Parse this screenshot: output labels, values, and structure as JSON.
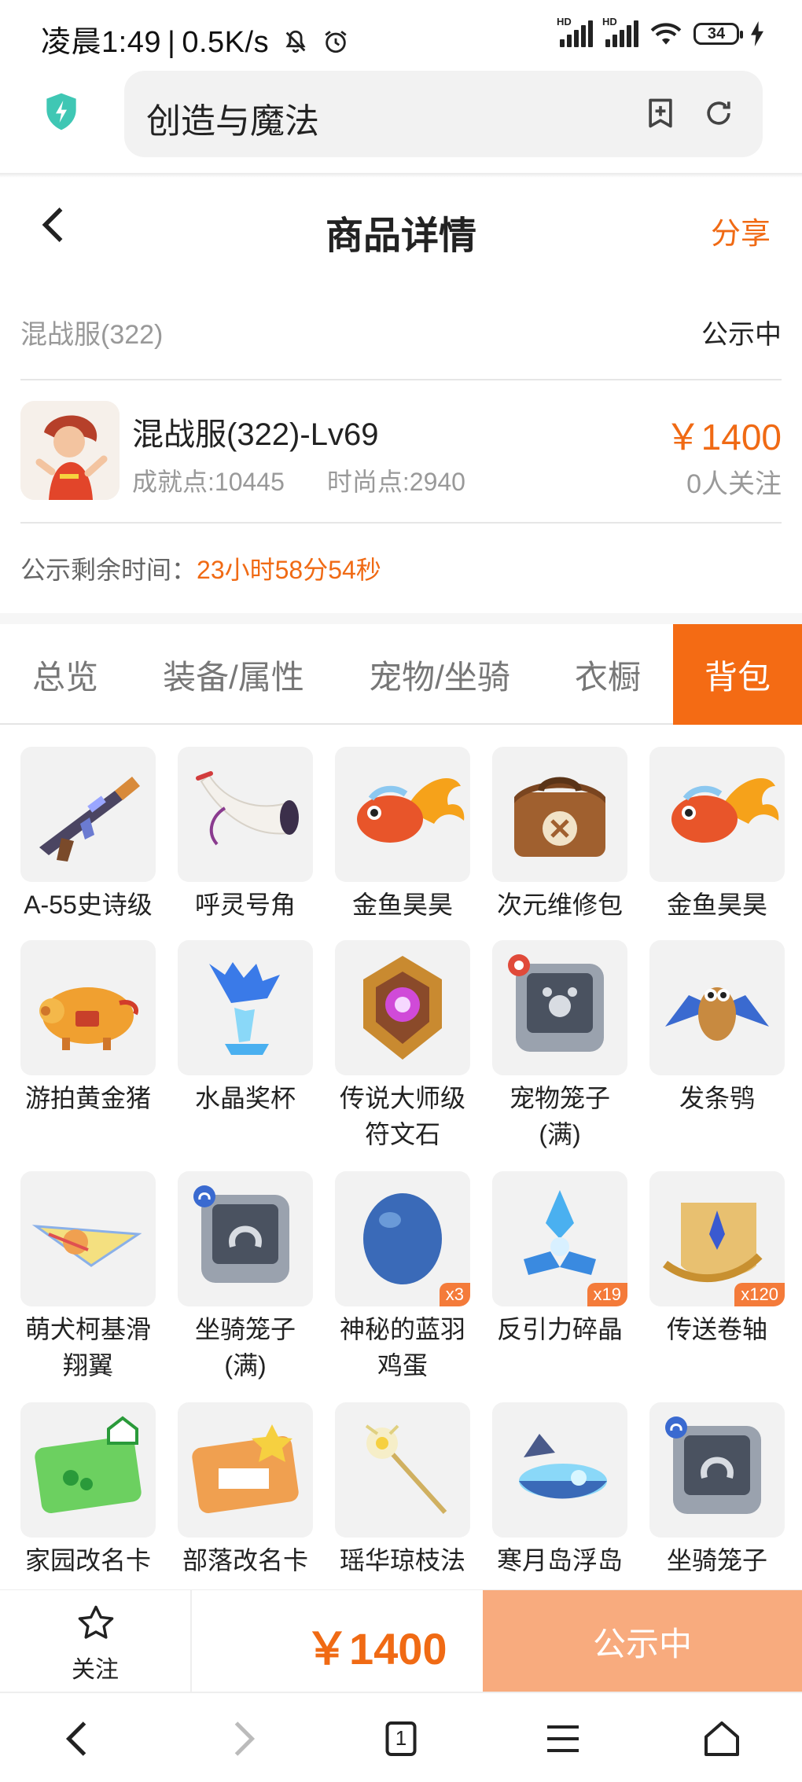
{
  "status_bar": {
    "time": "凌晨1:49",
    "speed": "0.5K/s",
    "battery": "34",
    "hd": "HD"
  },
  "browser": {
    "address": "创造与魔法"
  },
  "header": {
    "title": "商品详情",
    "share": "分享"
  },
  "server": {
    "name": "混战服(322)",
    "status": "公示中"
  },
  "product": {
    "name": "混战服(322)-Lv69",
    "achievement": "成就点:10445",
    "fashion": "时尚点:2940",
    "price": "￥1400",
    "followers": "0人关注"
  },
  "countdown": {
    "label": "公示剩余时间：",
    "value": "23小时58分54秒"
  },
  "tabs": [
    "总览",
    "装备/属性",
    "宠物/坐骑",
    "衣橱",
    "背包"
  ],
  "active_tab": "背包",
  "items": [
    {
      "label": "A-55史诗级",
      "icon": "gun-icon"
    },
    {
      "label": "呼灵号角",
      "icon": "horn-icon"
    },
    {
      "label": "金鱼昊昊",
      "icon": "goldfish-icon"
    },
    {
      "label": "次元维修包",
      "icon": "repair-bag-icon"
    },
    {
      "label": "金鱼昊昊",
      "icon": "goldfish-icon"
    },
    {
      "label": "游拍黄金猪",
      "icon": "golden-pig-icon"
    },
    {
      "label": "水晶奖杯",
      "icon": "crystal-trophy-icon"
    },
    {
      "label": "传说大师级符文石",
      "icon": "rune-stone-icon"
    },
    {
      "label": "宠物笼子(满)",
      "icon": "pet-cage-icon"
    },
    {
      "label": "发条鸮",
      "icon": "clockwork-owl-icon"
    },
    {
      "label": "萌犬柯基滑翔翼",
      "icon": "glider-icon"
    },
    {
      "label": "坐骑笼子(满)",
      "icon": "mount-cage-icon"
    },
    {
      "label": "神秘的蓝羽鸡蛋",
      "icon": "blue-egg-icon",
      "badge": "x3"
    },
    {
      "label": "反引力碎晶",
      "icon": "crystal-shard-icon",
      "badge": "x19"
    },
    {
      "label": "传送卷轴",
      "icon": "scroll-icon",
      "badge": "x120"
    },
    {
      "label": "家园改名卡",
      "icon": "home-card-icon"
    },
    {
      "label": "部落改名卡",
      "icon": "tribe-card-icon"
    },
    {
      "label": "瑶华琼枝法杖",
      "icon": "staff-icon"
    },
    {
      "label": "寒月岛浮岛皮肤",
      "icon": "floating-island-icon"
    },
    {
      "label": "坐骑笼子(满)",
      "icon": "mount-cage-icon"
    }
  ],
  "footer": {
    "follow": "关注",
    "price": "￥1400",
    "status": "公示中"
  },
  "nav": {
    "tab_count": "1"
  },
  "colors": {
    "accent": "#f06a14",
    "tab_active": "#f46b14",
    "status_btn": "#f8ab7e"
  }
}
